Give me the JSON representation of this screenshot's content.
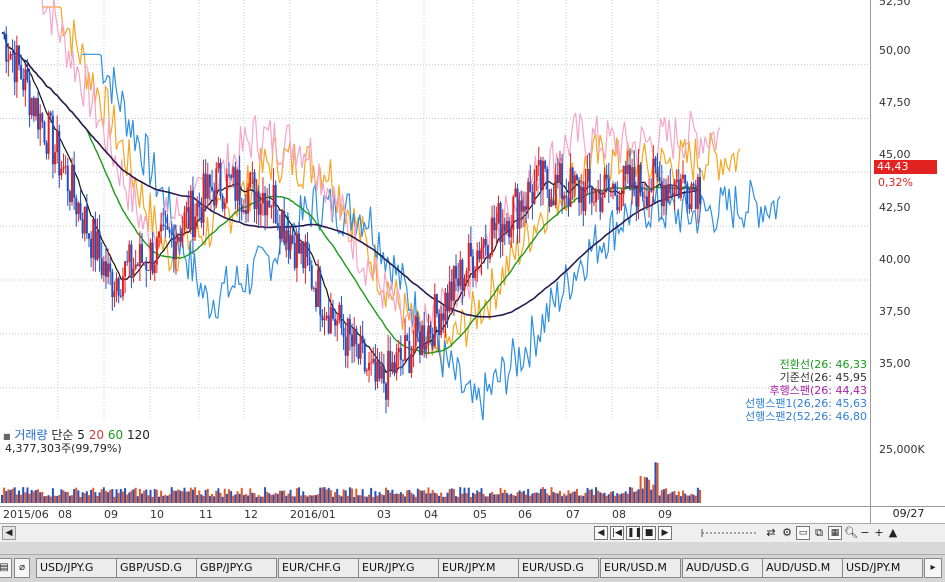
{
  "price_axis": {
    "ticks": [
      "52,50",
      "50,00",
      "47,50",
      "45,00",
      "42,50",
      "40,00",
      "37,50",
      "35,00"
    ],
    "current_price": "44,43",
    "change_pct": "0,32%"
  },
  "legend": [
    {
      "text": "전환선(26: 46,33",
      "color": "#1a9a1a"
    },
    {
      "text": "기준선(26: 45,95",
      "color": "#333333"
    },
    {
      "text": "후행스팬(26: 44,43",
      "color": "#aa22aa"
    },
    {
      "text": "선행스팬1(26,26: 45,63",
      "color": "#2f7fd8"
    },
    {
      "text": "선행스팬2(52,26: 46,80",
      "color": "#2f7fd8"
    }
  ],
  "volume": {
    "title": "거래량",
    "ma_label": "단순",
    "ma_periods": [
      "5",
      "20",
      "60",
      "120"
    ],
    "ma_colors": [
      "#222222",
      "#d43b3b",
      "#1a9a1a",
      "#222222"
    ],
    "value_text": "4,377,303주(99,79%)",
    "axis_tick": "25,000K"
  },
  "x_axis": {
    "ticks": [
      "2015/06",
      "08",
      "09",
      "10",
      "11",
      "12",
      "2016/01",
      "03",
      "04",
      "05",
      "06",
      "07",
      "08",
      "09"
    ],
    "current_date": "09/27"
  },
  "tabs": [
    "USD/JPY.G",
    "GBP/USD.G",
    "GBP/JPY.G",
    "EUR/CHF.G",
    "EUR/JPY.G",
    "EUR/JPY.M",
    "EUR/USD.G",
    "EUR/USD.M",
    "AUD/USD.G",
    "AUD/USD.M",
    "USD/JPY.M"
  ],
  "controls": {
    "icons": [
      "play-back-icon",
      "step-back-icon",
      "stop-icon",
      "step-forward-icon",
      "zoom-out-icon",
      "zoom-in-icon"
    ]
  },
  "chart_data": {
    "type": "line",
    "x": [
      "2015/06",
      "08",
      "09",
      "10",
      "11",
      "12",
      "2016/01",
      "03",
      "04",
      "05",
      "06",
      "07",
      "08",
      "09"
    ],
    "ylim": [
      33.5,
      53
    ],
    "series": [
      {
        "name": "",
        "values": [
          51.5,
          46,
          40,
          41.5,
          44.5,
          44,
          39,
          35,
          38,
          42,
          44.5,
          44,
          44.5,
          44.5
        ]
      }
    ]
  }
}
